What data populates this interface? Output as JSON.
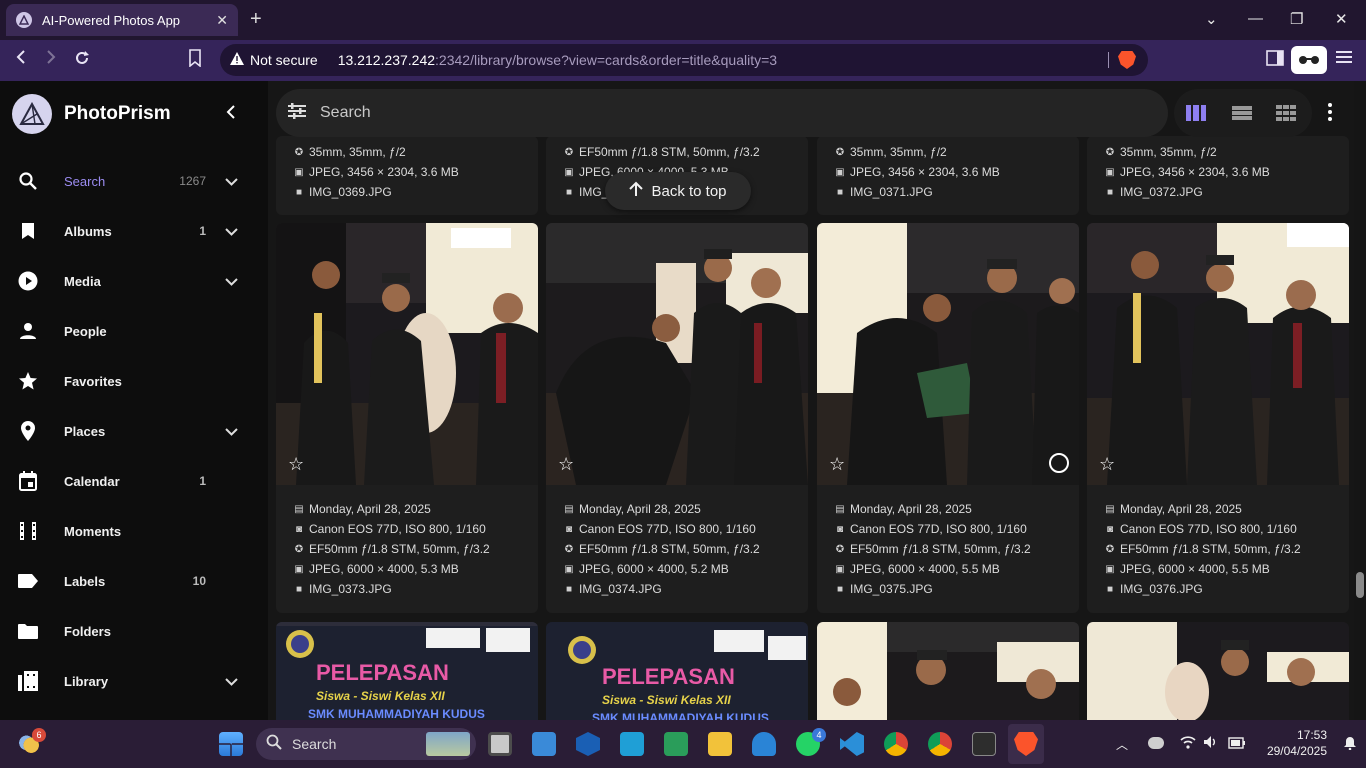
{
  "browser": {
    "tab_title": "AI-Powered Photos App",
    "new_tab": "+",
    "security_label": "Not secure",
    "url_host": "13.212.237.242",
    "url_rest": ":2342/library/browse?view=cards&order=title&quality=3"
  },
  "sidebar": {
    "brand": "PhotoPrism",
    "items": [
      {
        "label": "Search",
        "count": "1267",
        "icon": "search-icon",
        "expandable": true,
        "active": true
      },
      {
        "label": "Albums",
        "count": "1",
        "icon": "bookmark-icon",
        "expandable": true
      },
      {
        "label": "Media",
        "count": "",
        "icon": "play-circle-icon",
        "expandable": true
      },
      {
        "label": "People",
        "count": "",
        "icon": "person-icon",
        "expandable": false
      },
      {
        "label": "Favorites",
        "count": "",
        "icon": "star-icon",
        "expandable": false
      },
      {
        "label": "Places",
        "count": "",
        "icon": "map-pin-icon",
        "expandable": true
      },
      {
        "label": "Calendar",
        "count": "1",
        "icon": "calendar-icon",
        "expandable": false
      },
      {
        "label": "Moments",
        "count": "",
        "icon": "film-icon",
        "expandable": false
      },
      {
        "label": "Labels",
        "count": "10",
        "icon": "label-icon",
        "expandable": false
      },
      {
        "label": "Folders",
        "count": "",
        "icon": "folder-icon",
        "expandable": false
      },
      {
        "label": "Library",
        "count": "",
        "icon": "library-icon",
        "expandable": true
      }
    ]
  },
  "search": {
    "placeholder": "Search"
  },
  "back_to_top": "Back to top",
  "top_row": [
    {
      "lens": "35mm, 35mm, ƒ/2",
      "file": "JPEG, 3456 × 2304, 3.6 MB",
      "name": "IMG_0369.JPG"
    },
    {
      "lens": "EF50mm ƒ/1.8 STM, 50mm, ƒ/3.2",
      "file": "JPEG, 6000 × 4000, 5.3 MB",
      "name": "IMG_0370.JPG"
    },
    {
      "lens": "35mm, 35mm, ƒ/2",
      "file": "JPEG, 3456 × 2304, 3.6 MB",
      "name": "IMG_0371.JPG"
    },
    {
      "lens": "35mm, 35mm, ƒ/2",
      "file": "JPEG, 3456 × 2304, 3.6 MB",
      "name": "IMG_0372.JPG"
    }
  ],
  "cards": [
    {
      "date": "Monday, April 28, 2025",
      "camera": "Canon EOS 77D, ISO 800, 1/160",
      "lens": "EF50mm ƒ/1.8 STM, 50mm, ƒ/3.2",
      "file": "JPEG, 6000 × 4000, 5.3 MB",
      "name": "IMG_0373.JPG"
    },
    {
      "date": "Monday, April 28, 2025",
      "camera": "Canon EOS 77D, ISO 800, 1/160",
      "lens": "EF50mm ƒ/1.8 STM, 50mm, ƒ/3.2",
      "file": "JPEG, 6000 × 4000, 5.2 MB",
      "name": "IMG_0374.JPG"
    },
    {
      "date": "Monday, April 28, 2025",
      "camera": "Canon EOS 77D, ISO 800, 1/160",
      "lens": "EF50mm ƒ/1.8 STM, 50mm, ƒ/3.2",
      "file": "JPEG, 6000 × 4000, 5.5 MB",
      "name": "IMG_0375.JPG"
    },
    {
      "date": "Monday, April 28, 2025",
      "camera": "Canon EOS 77D, ISO 800, 1/160",
      "lens": "EF50mm ƒ/1.8 STM, 50mm, ƒ/3.2",
      "file": "JPEG, 6000 × 4000, 5.5 MB",
      "name": "IMG_0376.JPG"
    }
  ],
  "banner": {
    "title": "PELEPASAN",
    "subtitle": "Siswa - Siswi Kelas XII",
    "school": "SMK MUHAMMADIYAH KUDUS"
  },
  "taskbar": {
    "search_label": "Search",
    "weather_badge": "6",
    "whatsapp_badge": "4",
    "time": "17:53",
    "date": "29/04/2025"
  },
  "colors": {
    "accent": "#9b8cf0",
    "browser_bg": "#35245a",
    "tab_bg": "#3b2a55",
    "taskbar": "#2a1d36"
  }
}
